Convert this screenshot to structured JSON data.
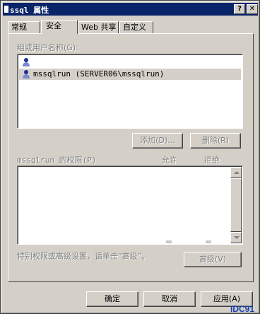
{
  "window": {
    "title": "ssql 属性",
    "help_glyph": "?",
    "close_glyph": "✕"
  },
  "tabs": [
    {
      "label": "常规"
    },
    {
      "label": "安全"
    },
    {
      "label": "Web 共享"
    },
    {
      "label": "自定义"
    }
  ],
  "security": {
    "users_label": "组或用户名称(G):",
    "users": [
      {
        "name": "",
        "icon": "user-group-icon",
        "selected": false
      },
      {
        "name": "mssqlrun (SERVER06\\mssqlrun)",
        "icon": "user-icon",
        "selected": true
      }
    ],
    "add_label": "添加(D)...",
    "remove_label": "删除(R)",
    "permissions_label": "mssqlrun 的权限(P)",
    "allow_header": "允许",
    "deny_header": "拒绝",
    "advanced_hint": "特别权限或高级设置，请单击“高级”。",
    "advanced_label": "高级(V)"
  },
  "footer": {
    "ok_label": "确定",
    "cancel_label": "取消",
    "apply_label": "应用(A)"
  },
  "watermark": "IDC91"
}
